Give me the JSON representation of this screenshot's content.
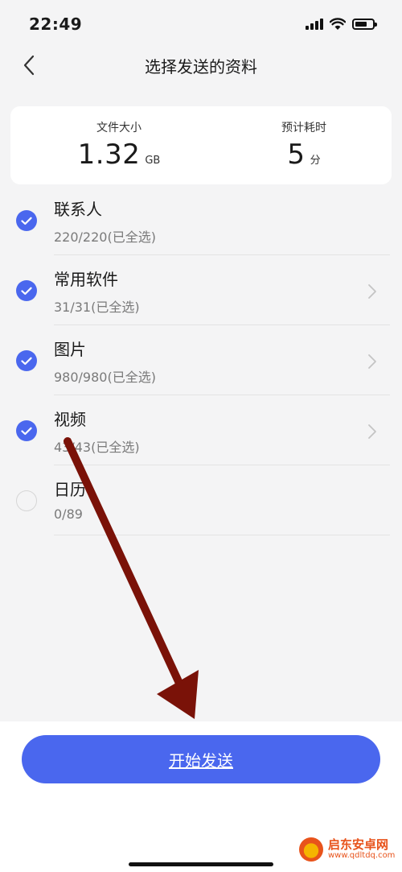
{
  "status_bar": {
    "time": "22:49"
  },
  "header": {
    "title": "选择发送的资料"
  },
  "summary": {
    "size_label": "文件大小",
    "size_value": "1.32",
    "size_unit": "GB",
    "time_label": "预计耗时",
    "time_value": "5",
    "time_unit": "分"
  },
  "items": [
    {
      "name": "联系人",
      "count": "220/220(已全选)",
      "checked": true,
      "has_chevron": false
    },
    {
      "name": "常用软件",
      "count": "31/31(已全选)",
      "checked": true,
      "has_chevron": true
    },
    {
      "name": "图片",
      "count": "980/980(已全选)",
      "checked": true,
      "has_chevron": true
    },
    {
      "name": "视频",
      "count": "43/43(已全选)",
      "checked": true,
      "has_chevron": true
    },
    {
      "name": "日历",
      "count": "0/89",
      "checked": false,
      "has_chevron": false
    }
  ],
  "send_button": {
    "label": "开始发送"
  },
  "watermark": {
    "title": "启东安卓网",
    "url": "www.qdltdq.com"
  },
  "colors": {
    "accent": "#4a67ee",
    "arrow": "#7a1208",
    "background": "#f4f4f5"
  }
}
